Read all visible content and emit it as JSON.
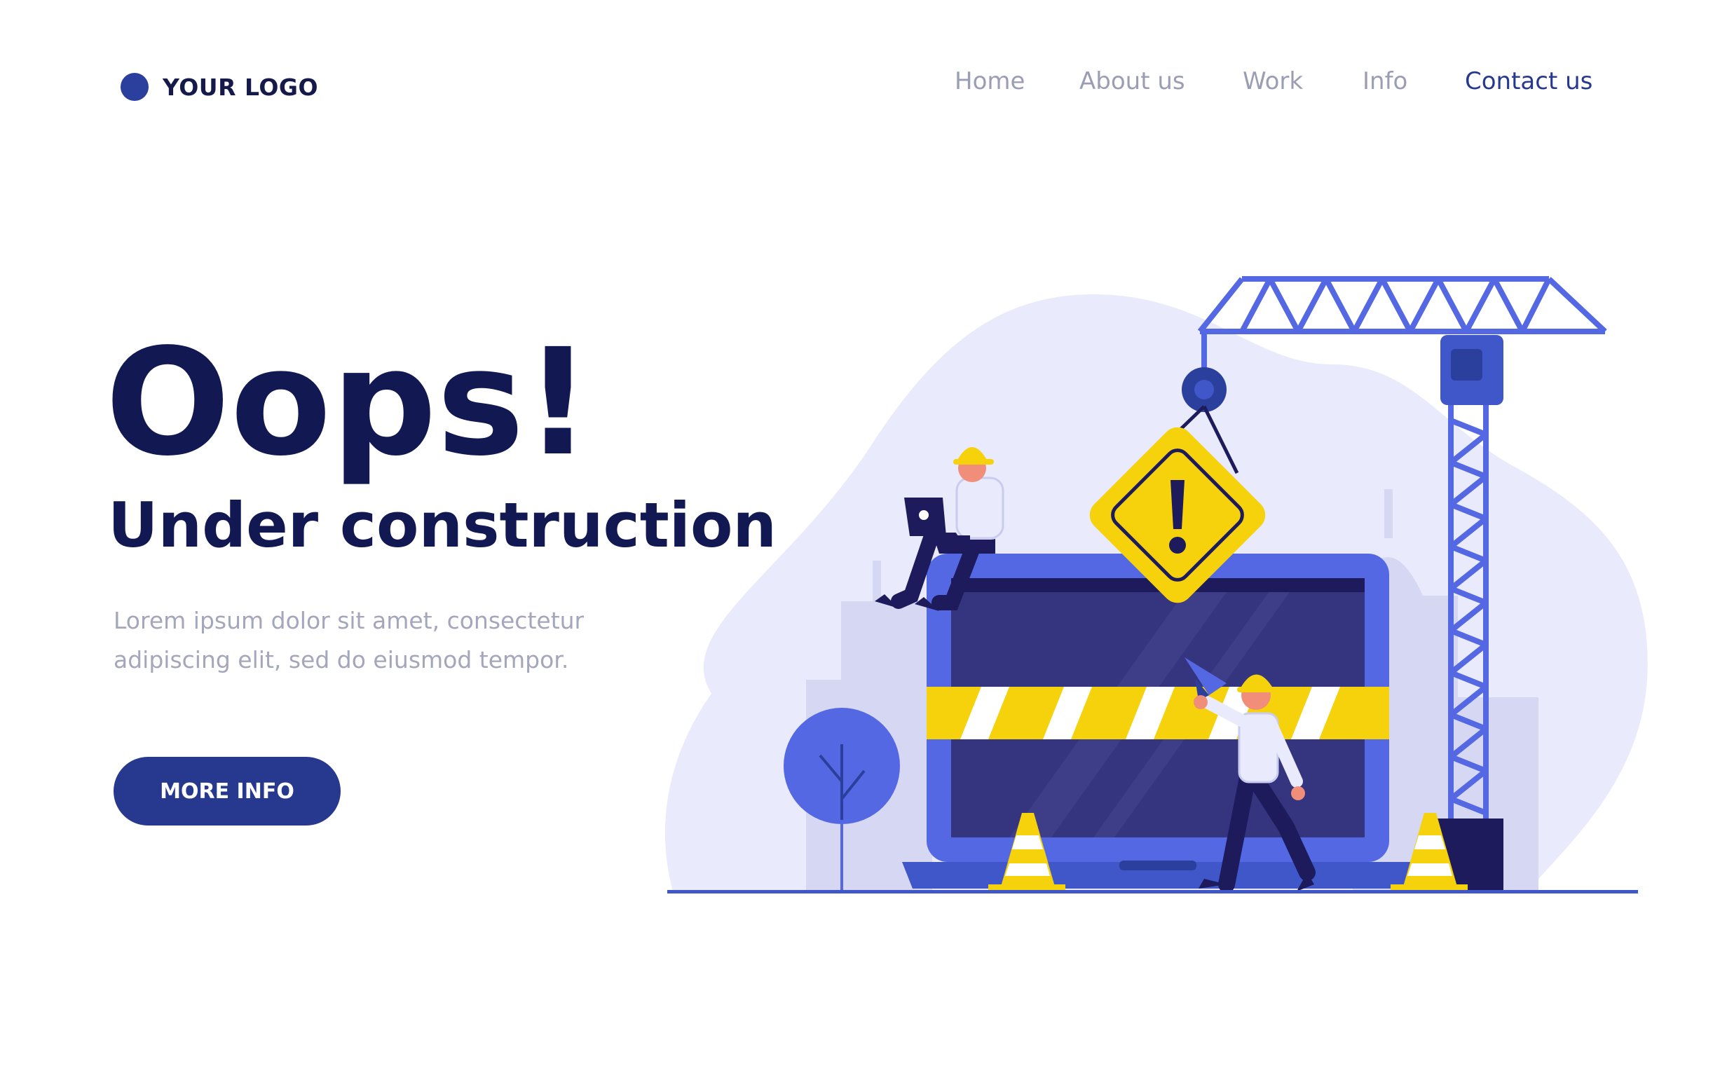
{
  "brand": {
    "logo_text": "YOUR LOGO"
  },
  "nav": {
    "items": [
      {
        "label": "Home"
      },
      {
        "label": "About us"
      },
      {
        "label": "Work"
      },
      {
        "label": "Info"
      },
      {
        "label": "Contact us"
      }
    ],
    "active": "Contact us"
  },
  "hero": {
    "title": "Oops!",
    "subtitle": "Under construction",
    "description": "Lorem ipsum dolor sit amet, consectetur adipiscing elit, sed do eiusmod tempor.",
    "button_label": "MORE INFO"
  },
  "illustration": {
    "icons": [
      "crane-icon",
      "warning-sign-icon",
      "laptop-icon",
      "worker-icon",
      "traffic-cone-icon",
      "tree-icon",
      "megaphone-icon",
      "building-icon"
    ]
  },
  "colors": {
    "primary": "#27398f",
    "dark_text": "#121852",
    "muted_text": "#9b9db4",
    "illustration_blue": "#5468e3",
    "warning_yellow": "#f5d20c",
    "blob": "#e9eafb"
  }
}
